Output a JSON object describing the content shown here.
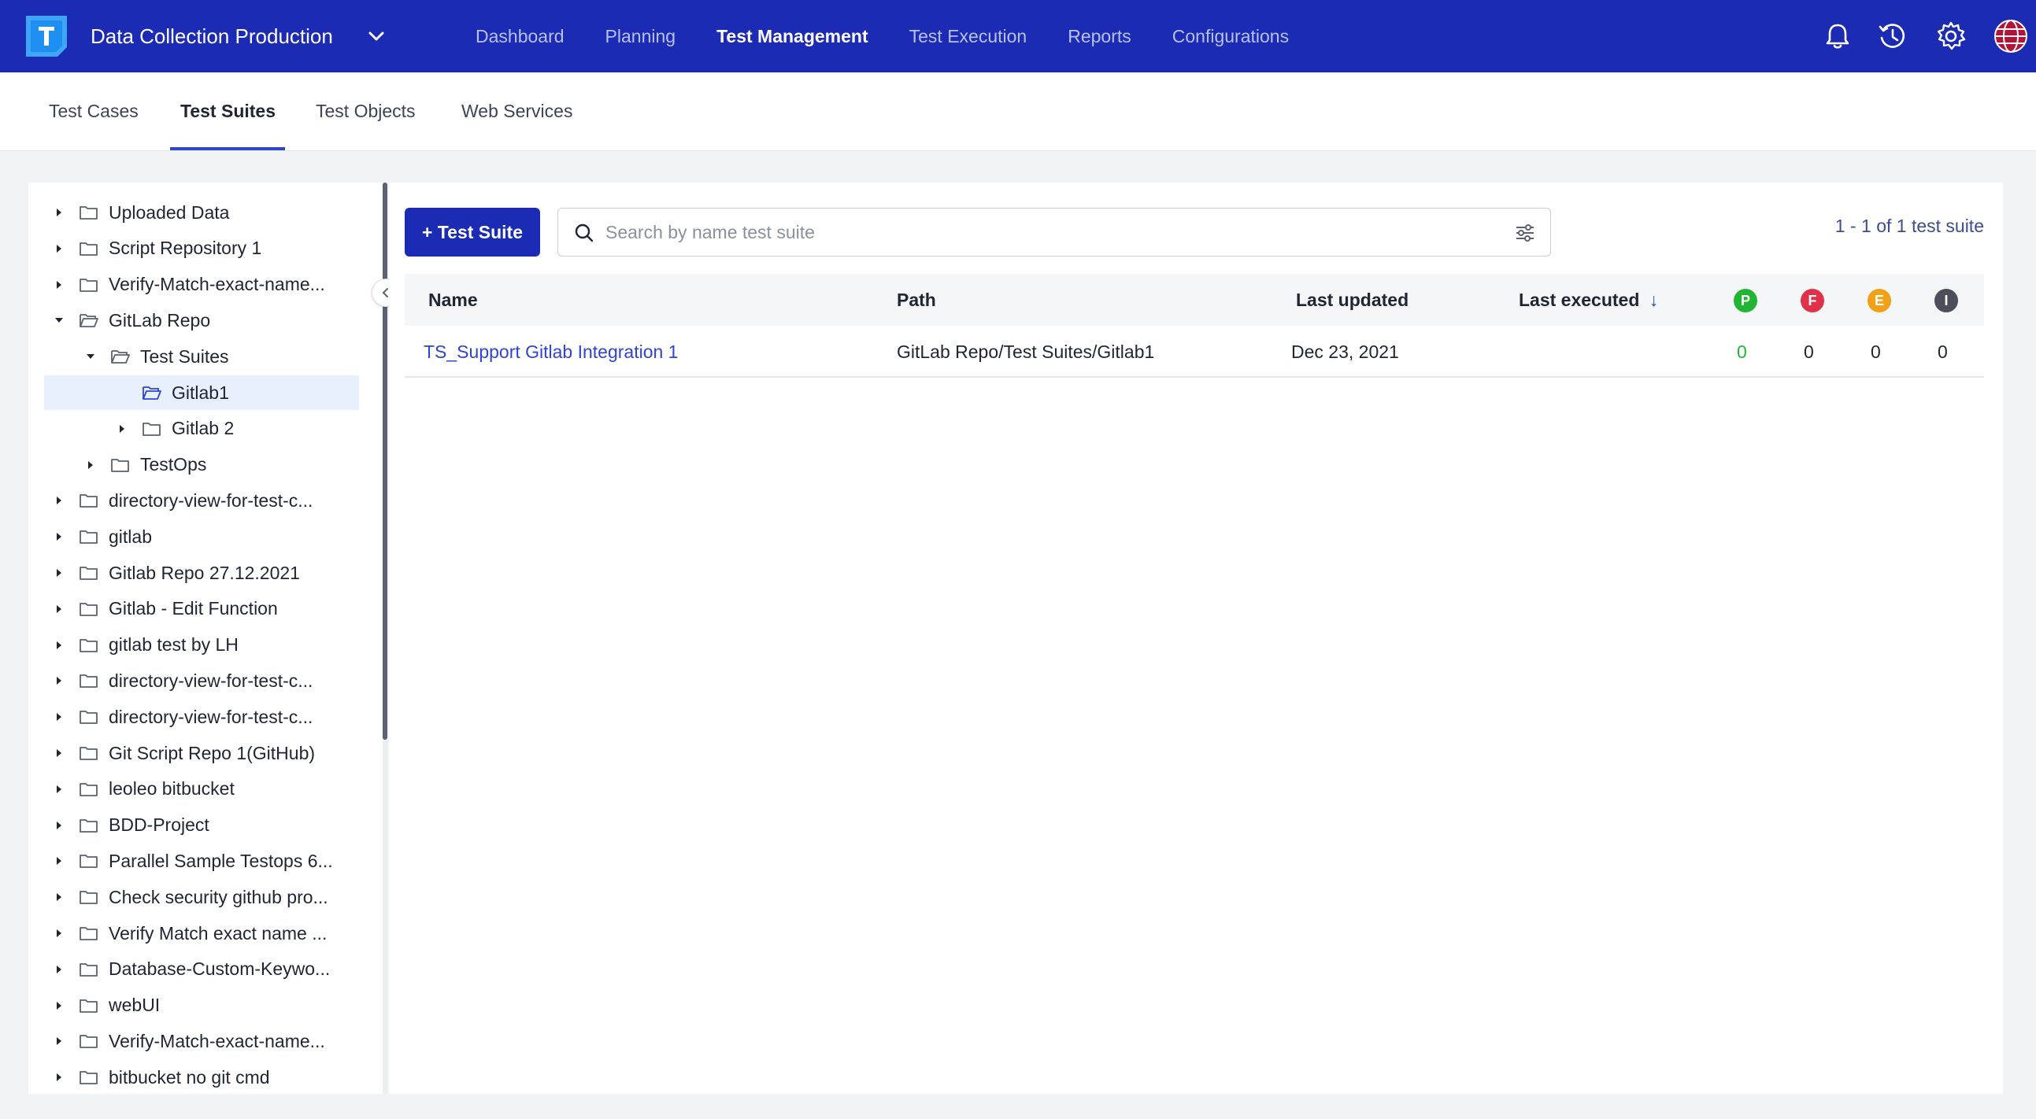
{
  "header": {
    "project_name": "Data Collection Production",
    "nav": [
      {
        "label": "Dashboard",
        "active": false
      },
      {
        "label": "Planning",
        "active": false
      },
      {
        "label": "Test Management",
        "active": true
      },
      {
        "label": "Test Execution",
        "active": false
      },
      {
        "label": "Reports",
        "active": false
      },
      {
        "label": "Configurations",
        "active": false
      }
    ],
    "icons": [
      "bell-icon",
      "history-icon",
      "gear-icon",
      "avatar-globe-icon"
    ]
  },
  "subtabs": [
    {
      "label": "Test Cases",
      "active": false
    },
    {
      "label": "Test Suites",
      "active": true
    },
    {
      "label": "Test Objects",
      "active": false
    },
    {
      "label": "Web Services",
      "active": false
    }
  ],
  "tree": [
    {
      "label": "Uploaded Data",
      "level": 0,
      "expanded": false,
      "selected": false
    },
    {
      "label": "Script Repository 1",
      "level": 0,
      "expanded": false,
      "selected": false
    },
    {
      "label": "Verify-Match-exact-name...",
      "level": 0,
      "expanded": false,
      "selected": false
    },
    {
      "label": "GitLab Repo",
      "level": 0,
      "expanded": true,
      "selected": false
    },
    {
      "label": "Test Suites",
      "level": 1,
      "expanded": true,
      "selected": false
    },
    {
      "label": "Gitlab1",
      "level": 2,
      "expanded": false,
      "selected": true,
      "leaf": true
    },
    {
      "label": "Gitlab 2",
      "level": 2,
      "expanded": false,
      "selected": false
    },
    {
      "label": "TestOps",
      "level": 1,
      "expanded": false,
      "selected": false
    },
    {
      "label": "directory-view-for-test-c...",
      "level": 0,
      "expanded": false,
      "selected": false
    },
    {
      "label": "gitlab",
      "level": 0,
      "expanded": false,
      "selected": false
    },
    {
      "label": "Gitlab Repo 27.12.2021",
      "level": 0,
      "expanded": false,
      "selected": false
    },
    {
      "label": "Gitlab - Edit Function",
      "level": 0,
      "expanded": false,
      "selected": false
    },
    {
      "label": "gitlab test by LH",
      "level": 0,
      "expanded": false,
      "selected": false
    },
    {
      "label": "directory-view-for-test-c...",
      "level": 0,
      "expanded": false,
      "selected": false
    },
    {
      "label": "directory-view-for-test-c...",
      "level": 0,
      "expanded": false,
      "selected": false
    },
    {
      "label": "Git Script Repo 1(GitHub)",
      "level": 0,
      "expanded": false,
      "selected": false
    },
    {
      "label": "leoleo bitbucket",
      "level": 0,
      "expanded": false,
      "selected": false
    },
    {
      "label": "BDD-Project",
      "level": 0,
      "expanded": false,
      "selected": false
    },
    {
      "label": "Parallel Sample Testops 6...",
      "level": 0,
      "expanded": false,
      "selected": false
    },
    {
      "label": "Check security github pro...",
      "level": 0,
      "expanded": false,
      "selected": false
    },
    {
      "label": "Verify Match exact name ...",
      "level": 0,
      "expanded": false,
      "selected": false
    },
    {
      "label": "Database-Custom-Keywo...",
      "level": 0,
      "expanded": false,
      "selected": false
    },
    {
      "label": "webUI",
      "level": 0,
      "expanded": false,
      "selected": false
    },
    {
      "label": "Verify-Match-exact-name...",
      "level": 0,
      "expanded": false,
      "selected": false
    },
    {
      "label": "bitbucket no git cmd",
      "level": 0,
      "expanded": false,
      "selected": false
    }
  ],
  "toolbar": {
    "add_label": "+ Test Suite",
    "search_placeholder": "Search by name test suite",
    "pager": "1 - 1 of 1 test suite"
  },
  "table": {
    "columns": {
      "name": "Name",
      "path": "Path",
      "last_updated": "Last updated",
      "last_executed": "Last executed",
      "sort_arrow": "↓"
    },
    "status_columns": [
      {
        "letter": "P",
        "color": "#22b533"
      },
      {
        "letter": "F",
        "color": "#e0314b"
      },
      {
        "letter": "E",
        "color": "#f2a016"
      },
      {
        "letter": "I",
        "color": "#4a4f5a"
      }
    ],
    "rows": [
      {
        "name": "TS_Support Gitlab Integration 1",
        "path": "GitLab Repo/Test Suites/Gitlab1",
        "last_updated": "Dec 23, 2021",
        "last_executed": "",
        "passed": "0",
        "failed": "0",
        "error": "0",
        "incomplete": "0"
      }
    ]
  },
  "colors": {
    "brand": "#1c2bb4",
    "link": "#2d44d6",
    "passed_count": "#22b533"
  }
}
